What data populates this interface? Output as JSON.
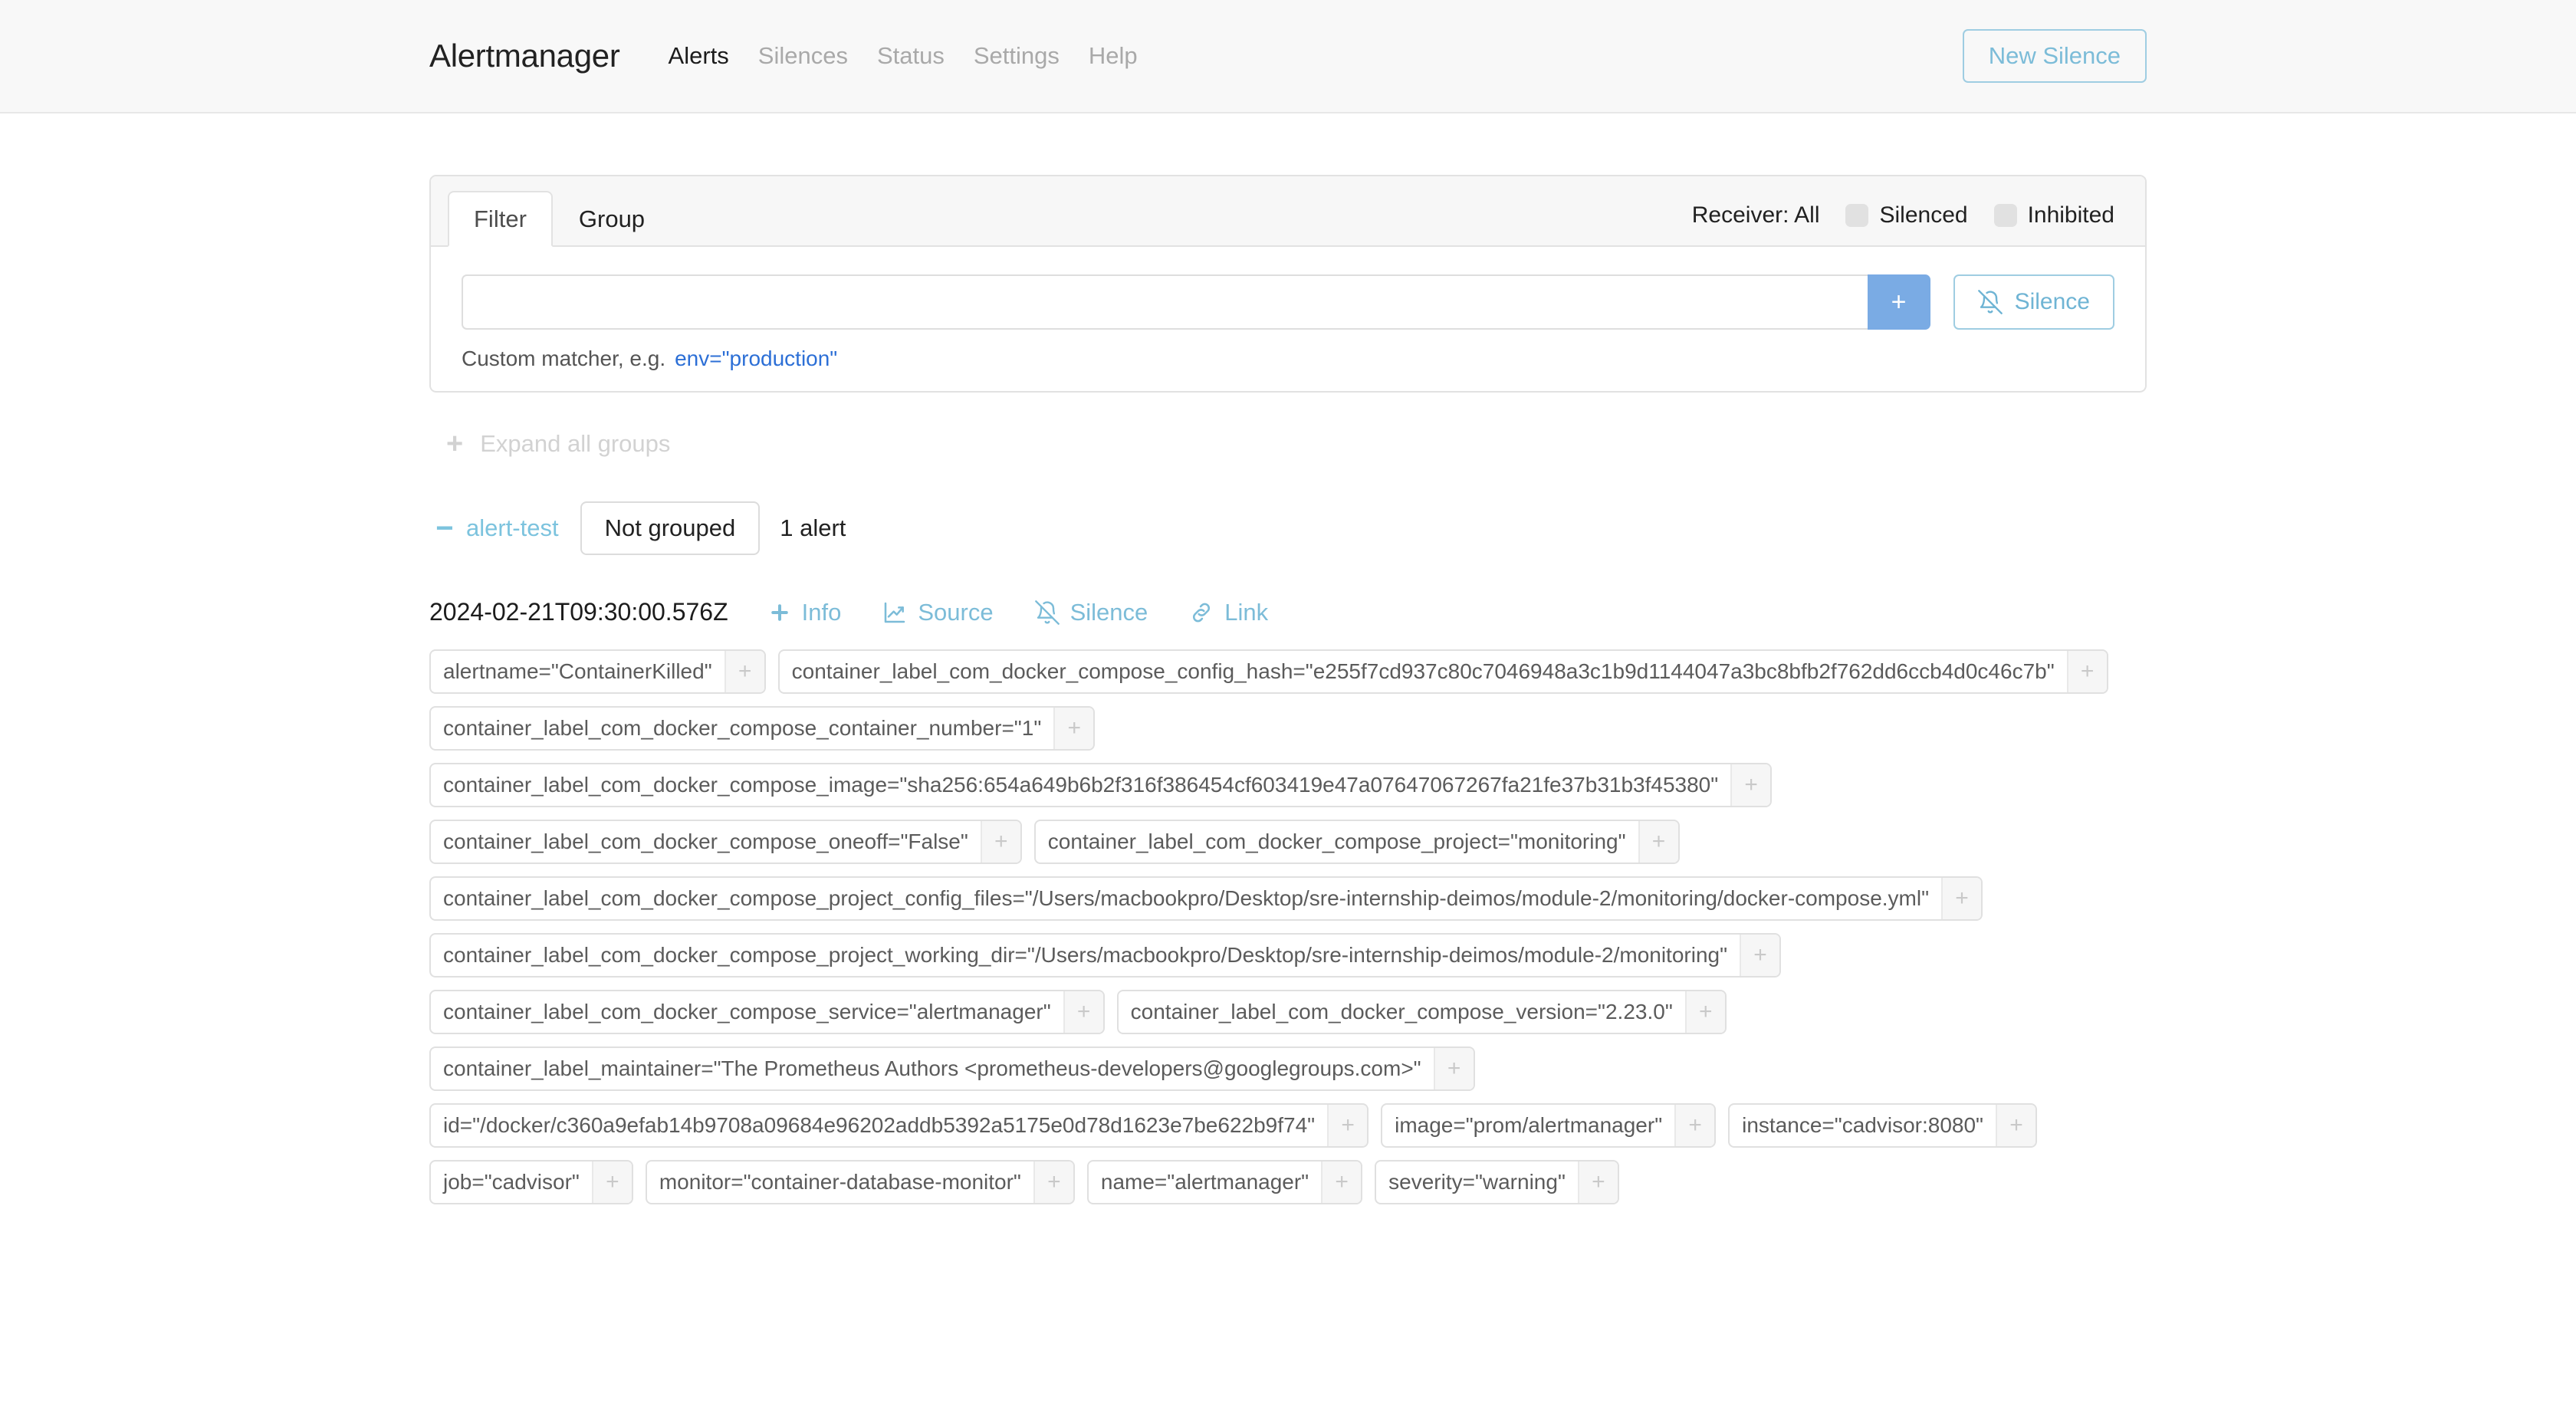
{
  "navbar": {
    "brand": "Alertmanager",
    "links": [
      {
        "label": "Alerts",
        "active": true
      },
      {
        "label": "Silences",
        "active": false
      },
      {
        "label": "Status",
        "active": false
      },
      {
        "label": "Settings",
        "active": false
      },
      {
        "label": "Help",
        "active": false
      }
    ],
    "new_silence_label": "New Silence",
    "accent_color": "#7cbcd8"
  },
  "filter_card": {
    "tabs": [
      {
        "label": "Filter",
        "active": true
      },
      {
        "label": "Group",
        "active": false
      }
    ],
    "receiver_label": "Receiver: All",
    "silenced_toggle_label": "Silenced",
    "inhibited_toggle_label": "Inhibited",
    "matcher_input_value": "",
    "matcher_input_placeholder": "",
    "add_button_label": "+",
    "silence_button_label": "Silence",
    "hint_text": "Custom matcher, e.g.",
    "hint_link": "env=\"production\"",
    "hint_link_color": "#2c6fd6",
    "add_button_color": "#7aabe4"
  },
  "expand_all": {
    "label": "Expand all groups",
    "icon": "plus-icon"
  },
  "group": {
    "collapse_icon": "minus-icon",
    "name": "alert-test",
    "grouping_label": "Not grouped",
    "alert_count_label": "1 alert"
  },
  "alert": {
    "timestamp": "2024-02-21T09:30:00.576Z",
    "actions": [
      {
        "label": "Info",
        "icon": "plus-icon"
      },
      {
        "label": "Source",
        "icon": "chart-line-icon"
      },
      {
        "label": "Silence",
        "icon": "bell-slash-icon"
      },
      {
        "label": "Link",
        "icon": "chain-link-icon"
      }
    ],
    "add_label": "+",
    "labels": [
      "alertname=\"ContainerKilled\"",
      "container_label_com_docker_compose_config_hash=\"e255f7cd937c80c7046948a3c1b9d1144047a3bc8bfb2f762dd6ccb4d0c46c7b\"",
      "container_label_com_docker_compose_container_number=\"1\"",
      "container_label_com_docker_compose_image=\"sha256:654a649b6b2f316f386454cf603419e47a07647067267fa21fe37b31b3f45380\"",
      "container_label_com_docker_compose_oneoff=\"False\"",
      "container_label_com_docker_compose_project=\"monitoring\"",
      "container_label_com_docker_compose_project_config_files=\"/Users/macbookpro/Desktop/sre-internship-deimos/module-2/monitoring/docker-compose.yml\"",
      "container_label_com_docker_compose_project_working_dir=\"/Users/macbookpro/Desktop/sre-internship-deimos/module-2/monitoring\"",
      "container_label_com_docker_compose_service=\"alertmanager\"",
      "container_label_com_docker_compose_version=\"2.23.0\"",
      "container_label_maintainer=\"The Prometheus Authors <prometheus-developers@googlegroups.com>\"",
      "id=\"/docker/c360a9efab14b9708a09684e96202addb5392a5175e0d78d1623e7be622b9f74\"",
      "image=\"prom/alertmanager\"",
      "instance=\"cadvisor:8080\"",
      "job=\"cadvisor\"",
      "monitor=\"container-database-monitor\"",
      "name=\"alertmanager\"",
      "severity=\"warning\""
    ]
  }
}
